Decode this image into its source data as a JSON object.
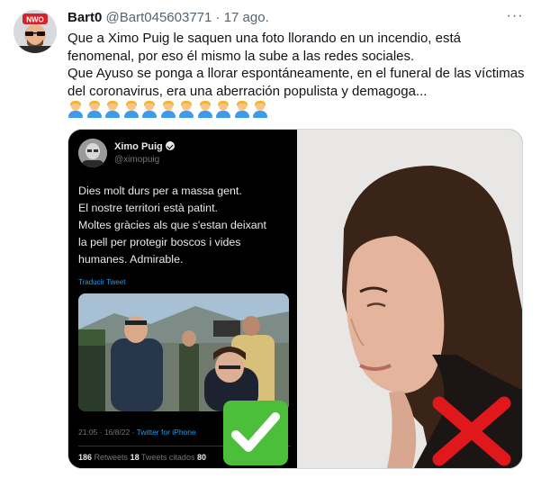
{
  "tweet": {
    "author_name": "Bart0",
    "author_handle": "@Bart045603771",
    "dot": "·",
    "date": "17 ago.",
    "more_label": "···",
    "lines": [
      "Que a Ximo Puig le saquen una foto llorando en un incendio, está",
      "fenomenal, por eso él mismo la sube a las redes sociales.",
      "Que Ayuso se ponga a llorar espontáneamente, en el funeral de las víctimas",
      "del coronavirus, era una aberración populista y demagoga..."
    ],
    "emoji_count": 11,
    "emoji_icon": "man-blond-hair-emoji"
  },
  "embedded_tweet": {
    "name": "Ximo Puig",
    "handle": "@ximopuig",
    "lines": [
      "Dies molt durs per a massa gent.",
      "El nostre territori està patint.",
      "Moltes gràcies als que s'estan deixant",
      "la pell per protegir boscos i vides",
      "humanes. Admirable."
    ],
    "translate_label": "Traducir Tweet",
    "time_date": "21:05 · 16/8/22 · ",
    "client": "Twitter for iPhone",
    "retweets_count": "186",
    "retweets_label": " Retweets  ",
    "quotes_count": "18",
    "quotes_label": " Tweets citados  ",
    "likes_count": "80"
  },
  "overlays": {
    "check_icon": "check-mark-button",
    "cross_icon": "cross-mark",
    "check_color": "#4bbf3a",
    "cross_color": "#e0181b"
  }
}
